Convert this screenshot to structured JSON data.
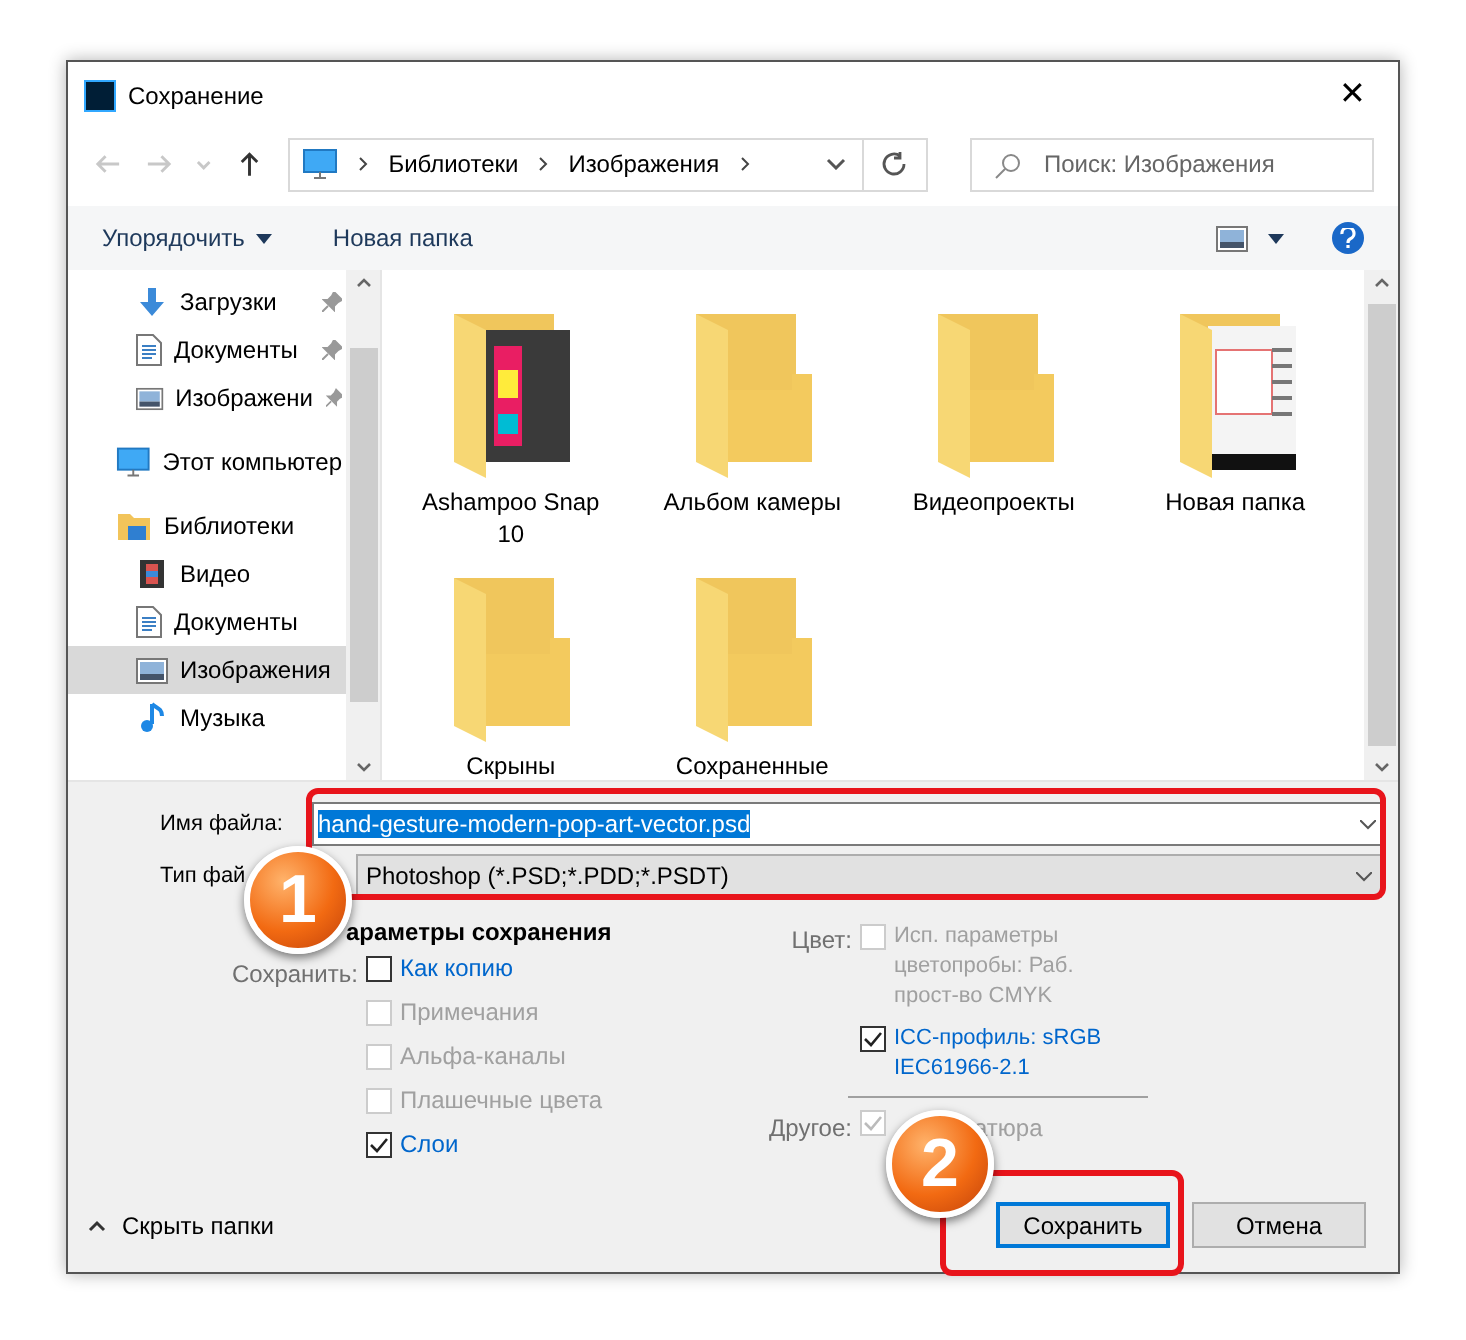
{
  "window": {
    "title": "Сохранение",
    "close": "✕"
  },
  "nav": [
    {
      "kind": "back",
      "disabled": true
    },
    {
      "kind": "forward",
      "disabled": true
    },
    {
      "kind": "recent",
      "disabled": true
    },
    {
      "kind": "up",
      "disabled": false
    }
  ],
  "breadcrumb": [
    "Библиотеки",
    "Изображения"
  ],
  "search": {
    "placeholder": "Поиск: Изображения"
  },
  "toolbar": {
    "organize": "Упорядочить",
    "new_folder": "Новая папка"
  },
  "sidebar": {
    "items": [
      {
        "label": "Загрузки",
        "kind": "download",
        "pinned": true,
        "selected": false
      },
      {
        "label": "Документы",
        "kind": "document",
        "pinned": true,
        "selected": false
      },
      {
        "label": "Изображени",
        "kind": "image",
        "pinned": true,
        "selected": false
      },
      {
        "label": "Этот компьютер",
        "kind": "computer",
        "pinned": false,
        "selected": false
      },
      {
        "label": "Библиотеки",
        "kind": "library",
        "pinned": false,
        "selected": false,
        "children": [
          {
            "label": "Видео",
            "kind": "video",
            "pinned": false,
            "selected": false
          },
          {
            "label": "Документы",
            "kind": "document",
            "pinned": false,
            "selected": false
          },
          {
            "label": "Изображения",
            "kind": "image",
            "pinned": false,
            "selected": true
          },
          {
            "label": "Музыка",
            "kind": "music",
            "pinned": false,
            "selected": false
          }
        ]
      }
    ]
  },
  "folders": [
    {
      "label": "Ashampoo Snap 10",
      "kind": "dark_preview"
    },
    {
      "label": "Альбом камеры",
      "kind": "plain"
    },
    {
      "label": "Видеопроекты",
      "kind": "plain"
    },
    {
      "label": "Новая папка",
      "kind": "doc_preview"
    },
    {
      "label": "Скрыны",
      "kind": "plain"
    },
    {
      "label": "Сохраненные",
      "kind": "plain"
    }
  ],
  "file_name": {
    "label": "Имя файла:",
    "value": "hand-gesture-modern-pop-art-vector.psd"
  },
  "file_type": {
    "label": "Тип фай",
    "value": "Photoshop (*.PSD;*.PDD;*.PSDT)"
  },
  "options": {
    "title": "араметры сохранения",
    "save_label": "Сохранить:",
    "save": [
      {
        "label": "Как копию",
        "checked": false,
        "disabled": false
      },
      {
        "label": "Примечания",
        "checked": false,
        "disabled": true
      },
      {
        "label": "Альфа-каналы",
        "checked": false,
        "disabled": true
      },
      {
        "label": "Плашечные цвета",
        "checked": false,
        "disabled": true
      },
      {
        "label": "Слои",
        "checked": true,
        "disabled": false
      }
    ],
    "color_label": "Цвет:",
    "color": [
      {
        "label": "Исп. параметры цветопробы:  Раб. прост-во CMYK",
        "checked": false,
        "disabled": true
      },
      {
        "label": "ICC-профиль:  sRGB IEC61966-2.1",
        "checked": true,
        "disabled": false
      }
    ],
    "other_label": "Другое:",
    "other": [
      {
        "label": "атюра",
        "checked": true,
        "disabled": true
      }
    ]
  },
  "hide_folders": "Скрыть папки",
  "buttons": [
    {
      "label": "Сохранить",
      "default": true
    },
    {
      "label": "Отмена",
      "default": false
    }
  ],
  "markers": [
    "1",
    "2"
  ]
}
